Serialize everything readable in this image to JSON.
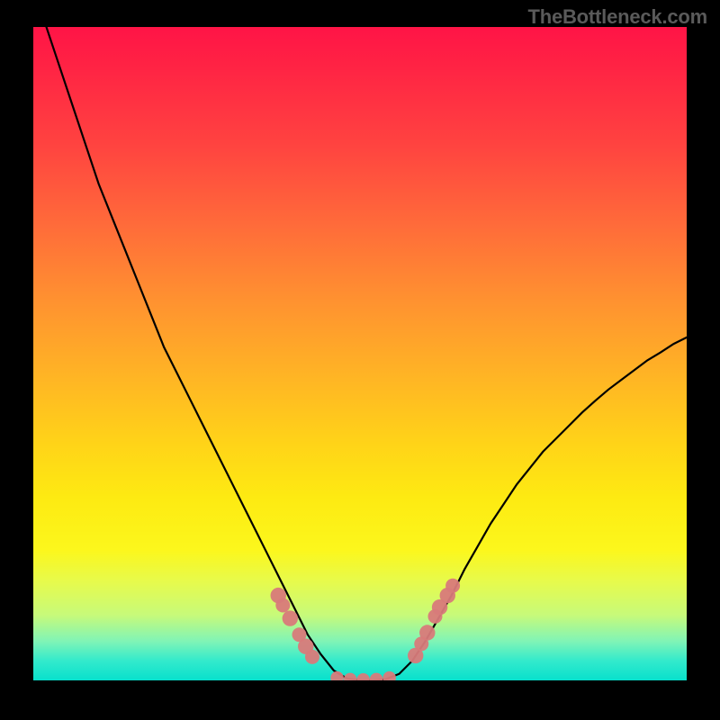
{
  "watermark": "TheBottleneck.com",
  "chart_data": {
    "type": "line",
    "title": "",
    "xlabel": "",
    "ylabel": "",
    "xlim": [
      0,
      100
    ],
    "ylim": [
      0,
      100
    ],
    "grid": false,
    "background": "rainbow-gradient-vertical",
    "series": [
      {
        "name": "curve",
        "x": [
          2,
          4,
          6,
          8,
          10,
          12,
          14,
          16,
          18,
          20,
          22,
          24,
          26,
          28,
          30,
          32,
          34,
          36,
          38,
          40,
          42,
          44,
          46,
          48,
          50,
          52,
          54,
          56,
          58,
          60,
          62,
          64,
          66,
          68,
          70,
          72,
          74,
          76,
          78,
          80,
          82,
          84,
          86,
          88,
          90,
          92,
          94,
          96,
          98,
          100
        ],
        "y": [
          100,
          94,
          88,
          82,
          76,
          71,
          66,
          61,
          56,
          51,
          47,
          43,
          39,
          35,
          31,
          27,
          23,
          19,
          15,
          11,
          7,
          4,
          1.5,
          0.3,
          0,
          0,
          0.2,
          1,
          3,
          6,
          9.5,
          13,
          17,
          20.5,
          24,
          27,
          30,
          32.5,
          35,
          37,
          39,
          41,
          42.8,
          44.5,
          46,
          47.5,
          49,
          50.2,
          51.5,
          52.5
        ]
      }
    ],
    "markers": {
      "left_branch": [
        {
          "x": 37.5,
          "y": 13,
          "r": 1.2
        },
        {
          "x": 38.2,
          "y": 11.5,
          "r": 1.1
        },
        {
          "x": 39.3,
          "y": 9.5,
          "r": 1.2
        },
        {
          "x": 40.7,
          "y": 7.0,
          "r": 1.1
        },
        {
          "x": 41.7,
          "y": 5.2,
          "r": 1.2
        },
        {
          "x": 42.7,
          "y": 3.6,
          "r": 1.1
        }
      ],
      "valley": [
        {
          "x": 46.5,
          "y": 0.4,
          "r": 1.0
        },
        {
          "x": 48.5,
          "y": 0.15,
          "r": 1.0
        },
        {
          "x": 50.5,
          "y": 0.1,
          "r": 1.0
        },
        {
          "x": 52.5,
          "y": 0.15,
          "r": 1.0
        },
        {
          "x": 54.5,
          "y": 0.4,
          "r": 1.0
        }
      ],
      "right_branch": [
        {
          "x": 58.5,
          "y": 3.8,
          "r": 1.2
        },
        {
          "x": 59.4,
          "y": 5.6,
          "r": 1.1
        },
        {
          "x": 60.3,
          "y": 7.3,
          "r": 1.2
        },
        {
          "x": 61.5,
          "y": 9.8,
          "r": 1.1
        },
        {
          "x": 62.2,
          "y": 11.2,
          "r": 1.2
        },
        {
          "x": 63.4,
          "y": 13.0,
          "r": 1.2
        },
        {
          "x": 64.2,
          "y": 14.5,
          "r": 1.1
        }
      ]
    }
  }
}
